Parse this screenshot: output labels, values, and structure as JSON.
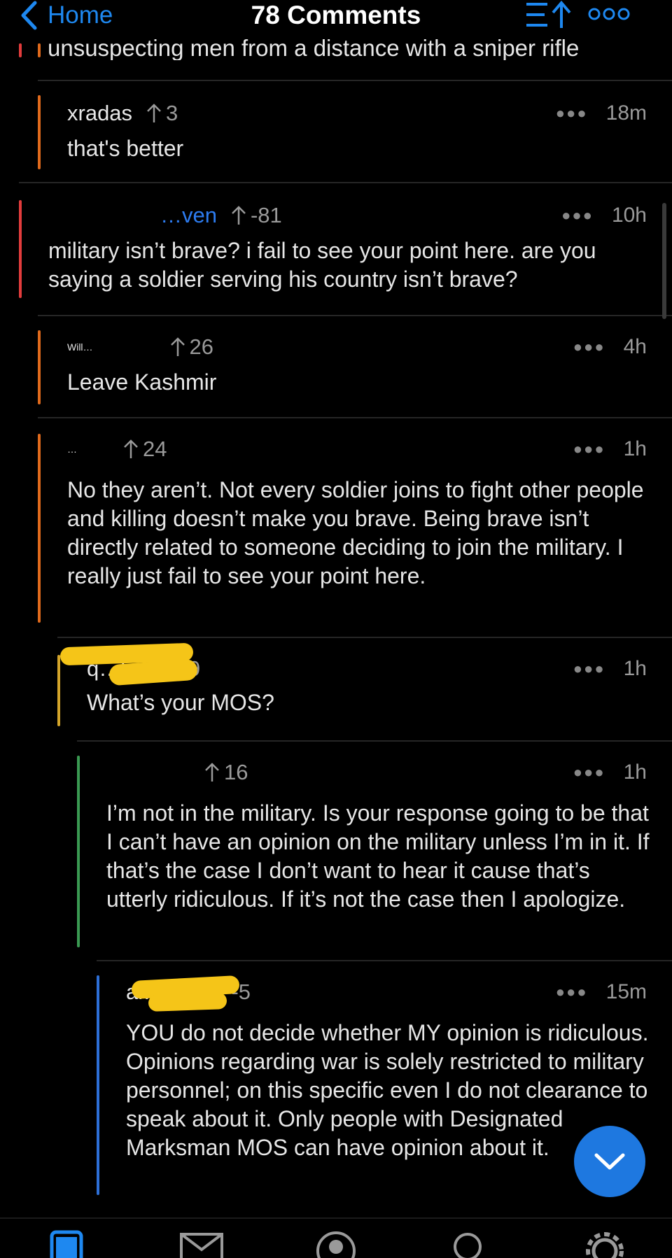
{
  "nav": {
    "back_label": "Home",
    "title": "78 Comments"
  },
  "cut_off_text": "unsuspecting men from a distance with a sniper rifle",
  "comments": [
    {
      "user": "xradas",
      "score": "3",
      "time": "18m",
      "body": "that's better",
      "bar_color": "#e06a1c"
    },
    {
      "user": "…ven",
      "score": "-81",
      "time": "10h",
      "body": "military isn’t brave? i fail to see your point here. are you saying a soldier serving his country isn’t brave?",
      "bar_color": "#e23c3c"
    },
    {
      "user": "Will…",
      "score": "26",
      "time": "4h",
      "body": "Leave Kashmir",
      "bar_color": "#e06a1c"
    },
    {
      "user": "…",
      "score": "24",
      "time": "1h",
      "body": "No they aren’t. Not every soldier joins to fight other people and killing doesn’t make you brave. Being brave isn’t directly related to someone deciding to join the military. I really just fail to see your point here.",
      "bar_color": "#e06a1c"
    },
    {
      "user": "q…h",
      "score": "-19",
      "time": "1h",
      "body": "What’s your MOS?",
      "bar_color": "#d4a52a"
    },
    {
      "user": "",
      "score": "16",
      "time": "1h",
      "body": "I’m not in the military. Is your response going to be that I can’t have an opinion on the military unless I’m in it. If that’s the case I don’t want to hear it cause that’s utterly ridiculous. If it’s not the case then I apologize.",
      "bar_color": "#3a9a52"
    },
    {
      "user": "ai…tch",
      "score": "-5",
      "time": "15m",
      "body": "YOU do not decide whether MY opinion is ridiculous. Opinions regarding war is solely restricted to military personnel; on this specific even I do not clearance to speak about it. Only people with Designated Marksman MOS can have opinion about it.",
      "bar_color": "#2d6fd6"
    }
  ],
  "colors": {
    "accent": "#1e88f0",
    "background": "#000000",
    "redaction": "#f5c518"
  },
  "icons": [
    "chevron-left-icon",
    "sort-icon",
    "more-icon",
    "chevron-down-icon",
    "posts-tab-icon",
    "inbox-icon",
    "profile-icon",
    "search-icon",
    "settings-icon"
  ]
}
